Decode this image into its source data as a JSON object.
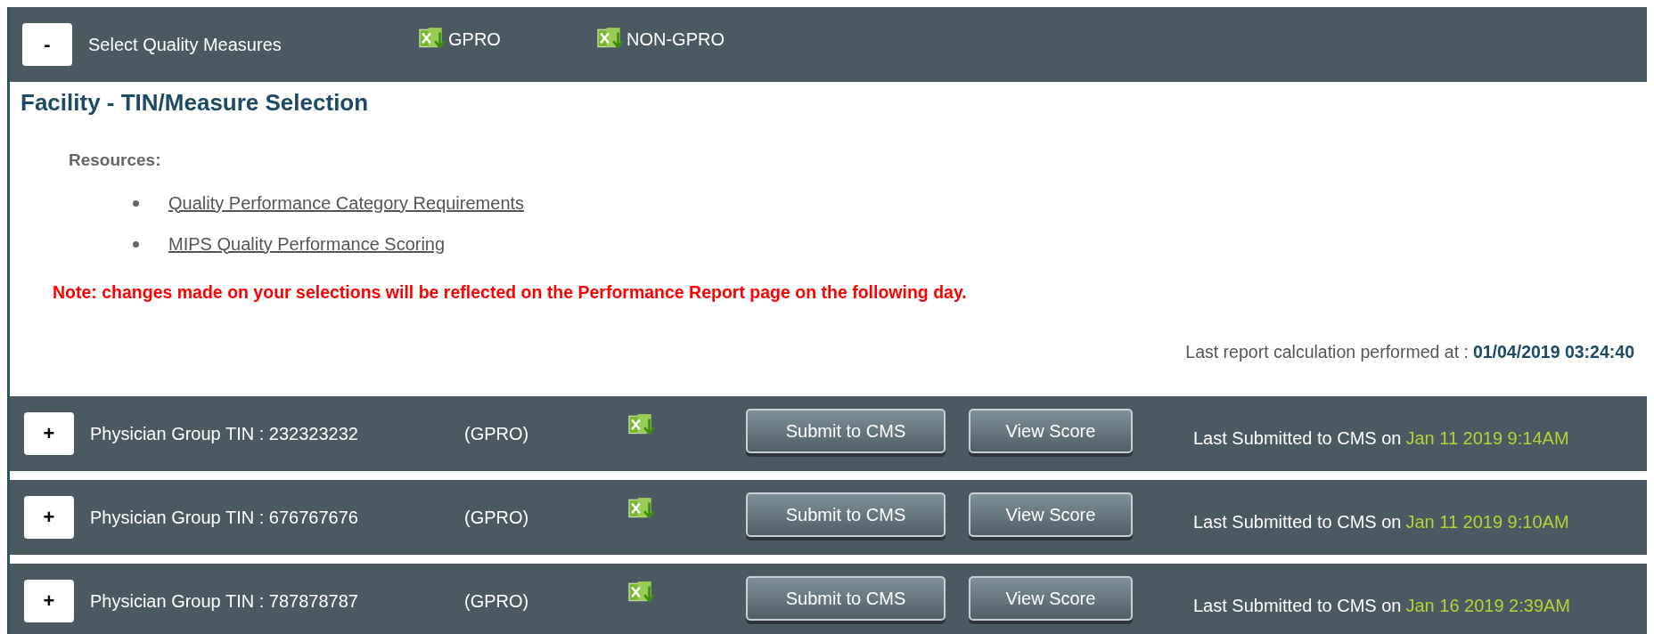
{
  "header": {
    "toggle": "-",
    "title": "Select Quality Measures",
    "exports": [
      {
        "label": "GPRO"
      },
      {
        "label": "NON-GPRO"
      }
    ]
  },
  "section_title": "Facility - TIN/Measure Selection",
  "resources": {
    "label": "Resources:",
    "links": [
      "Quality Performance Category Requirements",
      "MIPS Quality Performance Scoring"
    ]
  },
  "note": "Note: changes made on your selections will be reflected on the Performance Report page on the following day.",
  "last_calculation": {
    "label": "Last report calculation performed at :",
    "value": "01/04/2019 03:24:40"
  },
  "groups": [
    {
      "toggle": "+",
      "tin": "Physician Group TIN : 232323232",
      "type": "(GPRO)",
      "submit": "Submit to CMS",
      "view": "View Score",
      "submitted_label": "Last Submitted to CMS on",
      "submitted_date": "Jan 11 2019 9:14AM"
    },
    {
      "toggle": "+",
      "tin": "Physician Group TIN : 676767676",
      "type": "(GPRO)",
      "submit": "Submit to CMS",
      "view": "View Score",
      "submitted_label": "Last Submitted to CMS on",
      "submitted_date": "Jan 11 2019 9:10AM"
    },
    {
      "toggle": "+",
      "tin": "Physician Group TIN : 787878787",
      "type": "(GPRO)",
      "submit": "Submit to CMS",
      "view": "View Score",
      "submitted_label": "Last Submitted to CMS on",
      "submitted_date": "Jan 16 2019 2:39AM"
    }
  ]
}
